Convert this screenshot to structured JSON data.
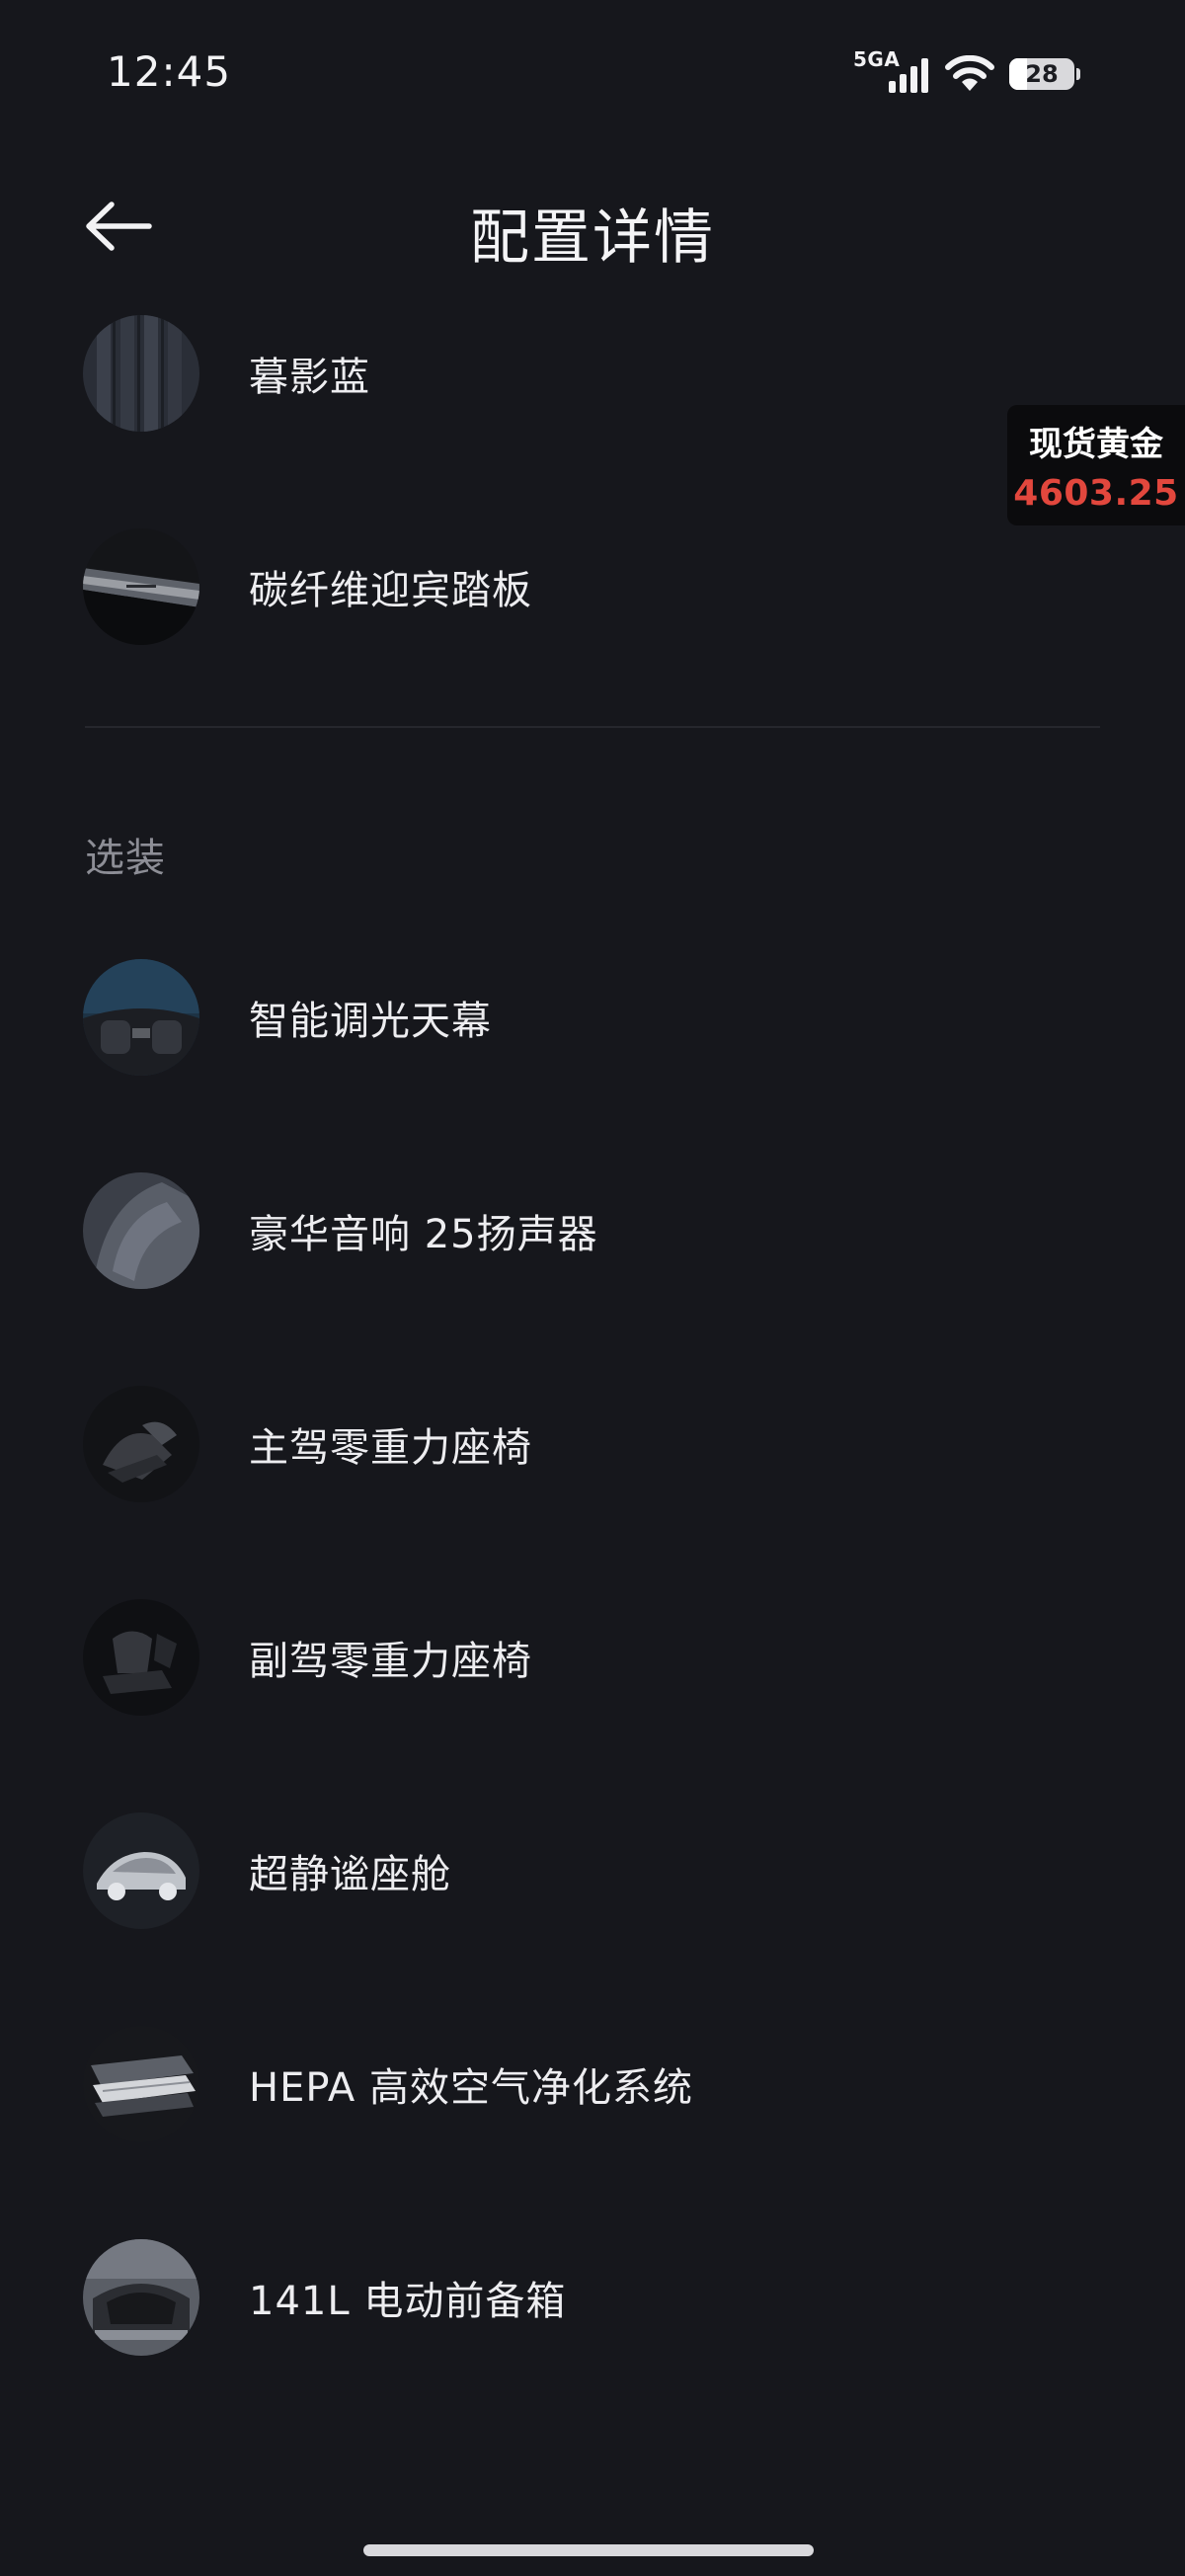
{
  "status_bar": {
    "time": "12:45",
    "network": "5GA",
    "battery": "28",
    "battery_level": 0.28,
    "icons": [
      "signal-icon",
      "wifi-icon",
      "battery-icon"
    ]
  },
  "header": {
    "title": "配置详情",
    "back_icon": "arrow-left-icon"
  },
  "standard_items": [
    {
      "label": "暮影蓝",
      "thumb": "color-swatch-thumbnail"
    },
    {
      "label": "碳纤维迎宾踏板",
      "thumb": "sill-plate-thumbnail"
    }
  ],
  "options_section": {
    "title": "选装",
    "items": [
      {
        "label": "智能调光天幕",
        "thumb": "sunroof-thumbnail"
      },
      {
        "label": "豪华音响 25扬声器",
        "thumb": "speaker-thumbnail"
      },
      {
        "label": "主驾零重力座椅",
        "thumb": "driver-seat-thumbnail"
      },
      {
        "label": "副驾零重力座椅",
        "thumb": "passenger-seat-thumbnail"
      },
      {
        "label": "超静谧座舱",
        "thumb": "quiet-cabin-thumbnail"
      },
      {
        "label": "HEPA 高效空气净化系统",
        "thumb": "hepa-filter-thumbnail"
      },
      {
        "label": "141L 电动前备箱",
        "thumb": "frunk-thumbnail"
      }
    ]
  },
  "gold_widget": {
    "label": "现货黄金",
    "price": "4603.25",
    "price_color": "#e2473d"
  },
  "colors": {
    "background": "#16171c",
    "text": "#ededf0",
    "muted": "#8d8e96"
  }
}
